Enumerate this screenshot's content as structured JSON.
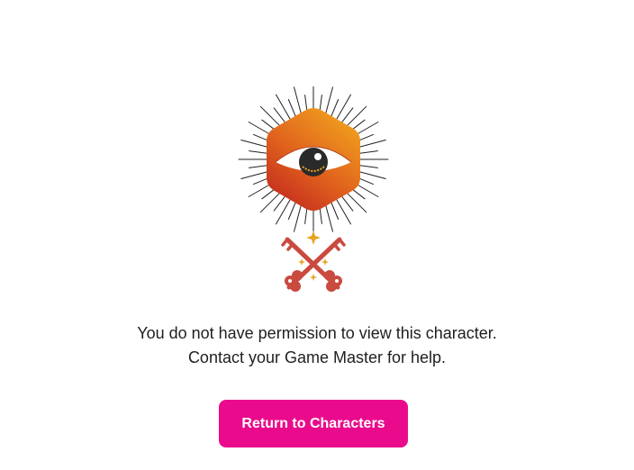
{
  "message": {
    "line1": "You do not have permission to view this character.",
    "line2": "Contact your Game Master for help."
  },
  "actions": {
    "return_label": "Return to Characters"
  },
  "icons": {
    "emblem": "all-seeing-eye-icon",
    "keys": "crossed-keys-icon"
  },
  "colors": {
    "accent": "#ea0b8c",
    "hexagon_top": "#f0a21f",
    "hexagon_bottom": "#c62a1f",
    "keys": "#c94a3f",
    "sparkle": "#e5a31f"
  }
}
